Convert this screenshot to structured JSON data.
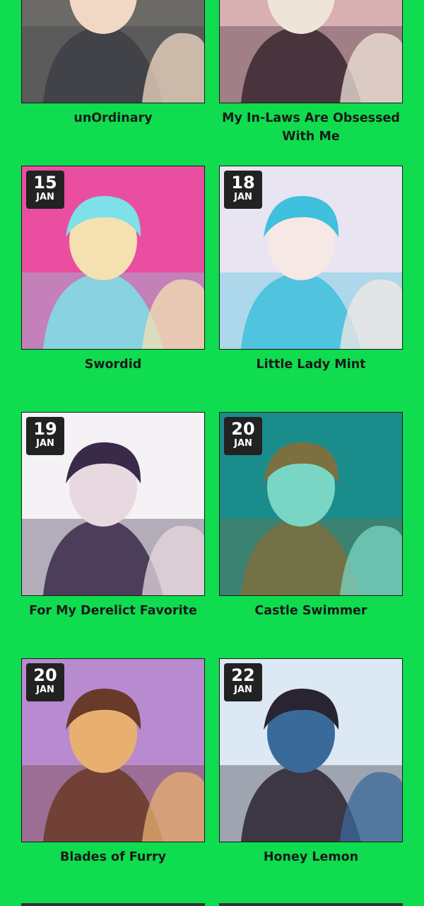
{
  "comics": [
    {
      "title": "unOrdinary",
      "release_day": "",
      "release_month": "",
      "palette": [
        "#6c6a66",
        "#3d3f47",
        "#f0d8c4"
      ]
    },
    {
      "title": "My In-Laws Are Obsessed With Me",
      "release_day": "",
      "release_month": "",
      "palette": [
        "#d8b0b4",
        "#3a2630",
        "#efe4d8"
      ]
    },
    {
      "title": "Swordid",
      "release_day": "15",
      "release_month": "JAN",
      "palette": [
        "#e94ea0",
        "#7ee0e8",
        "#f4e0b0"
      ]
    },
    {
      "title": "Little Lady Mint",
      "release_day": "18",
      "release_month": "JAN",
      "palette": [
        "#e8e4f2",
        "#3fc0dc",
        "#f6e8e4"
      ]
    },
    {
      "title": "For My Derelict Favorite",
      "release_day": "19",
      "release_month": "JAN",
      "palette": [
        "#f4f2f4",
        "#3a2a4a",
        "#e8d8e0"
      ]
    },
    {
      "title": "Castle Swimmer",
      "release_day": "20",
      "release_month": "JAN",
      "palette": [
        "#1b8c8c",
        "#7c7040",
        "#7ad6c4"
      ]
    },
    {
      "title": "Blades of Furry",
      "release_day": "20",
      "release_month": "JAN",
      "palette": [
        "#b88ad0",
        "#6a3a28",
        "#e8b070"
      ]
    },
    {
      "title": "Honey Lemon",
      "release_day": "22",
      "release_month": "JAN",
      "palette": [
        "#dce8f4",
        "#2a2430",
        "#3a6a9a"
      ]
    }
  ]
}
